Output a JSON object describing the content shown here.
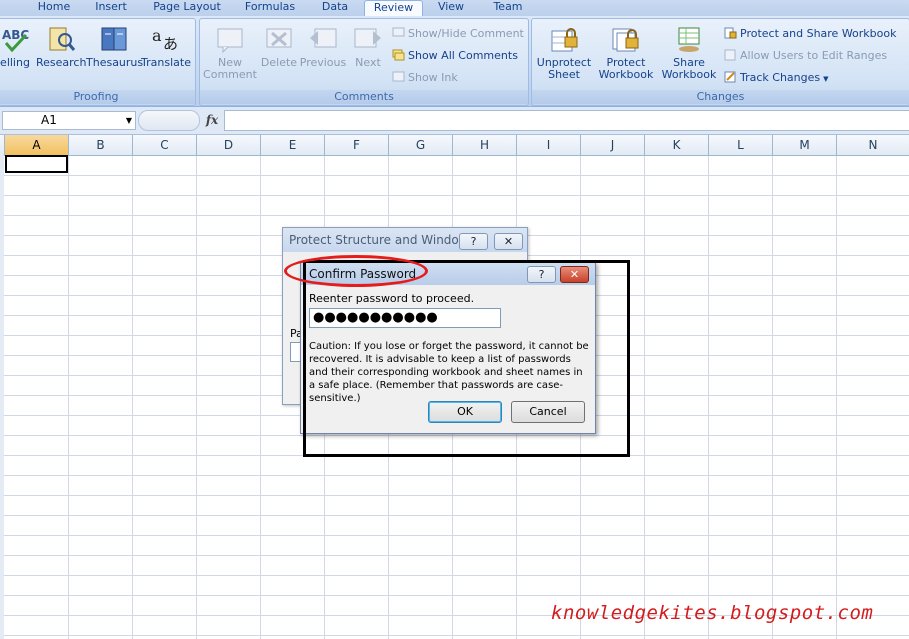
{
  "ribbon": {
    "tabs": [
      "Home",
      "Insert",
      "Page Layout",
      "Formulas",
      "Data",
      "Review",
      "View",
      "Team"
    ],
    "active_tab": "Review",
    "groups": {
      "proofing": {
        "label": "Proofing",
        "buttons": [
          "elling",
          "Research",
          "Thesaurus",
          "Translate"
        ]
      },
      "comments": {
        "label": "Comments",
        "buttons": [
          "New\nComment",
          "Delete",
          "Previous",
          "Next"
        ],
        "small": [
          "Show/Hide Comment",
          "Show All Comments",
          "Show Ink"
        ]
      },
      "changes": {
        "label": "Changes",
        "buttons": [
          "Unprotect\nSheet",
          "Protect\nWorkbook",
          "Share\nWorkbook"
        ],
        "small": [
          "Protect and Share Workbook",
          "Allow Users to Edit Ranges",
          "Track Changes"
        ]
      }
    }
  },
  "formula_bar": {
    "name_box": "A1",
    "fx_label": "fx",
    "value": ""
  },
  "grid": {
    "columns": [
      "A",
      "B",
      "C",
      "D",
      "E",
      "F",
      "G",
      "H",
      "I",
      "J",
      "K",
      "L",
      "M",
      "N"
    ],
    "selected_column": "A"
  },
  "back_dialog": {
    "title": "Protect Structure and Windows",
    "help": "?",
    "close": "✕",
    "partial_label": "Pa"
  },
  "confirm_dialog": {
    "title": "Confirm Password",
    "help": "?",
    "close": "✕",
    "prompt": "Reenter password to proceed.",
    "password_mask": "●●●●●●●●●●●",
    "caution": "Caution: If you lose or forget the password, it cannot be recovered. It is advisable to keep a list of passwords and their corresponding workbook and sheet names in a safe place.  (Remember that passwords are case-sensitive.)",
    "ok": "OK",
    "cancel": "Cancel"
  },
  "watermark": "knowledgekites.blogspot.com",
  "colors": {
    "ribbon_text": "#15428b",
    "annotation_red": "#e51c1c",
    "close_button": "#c9432a"
  }
}
